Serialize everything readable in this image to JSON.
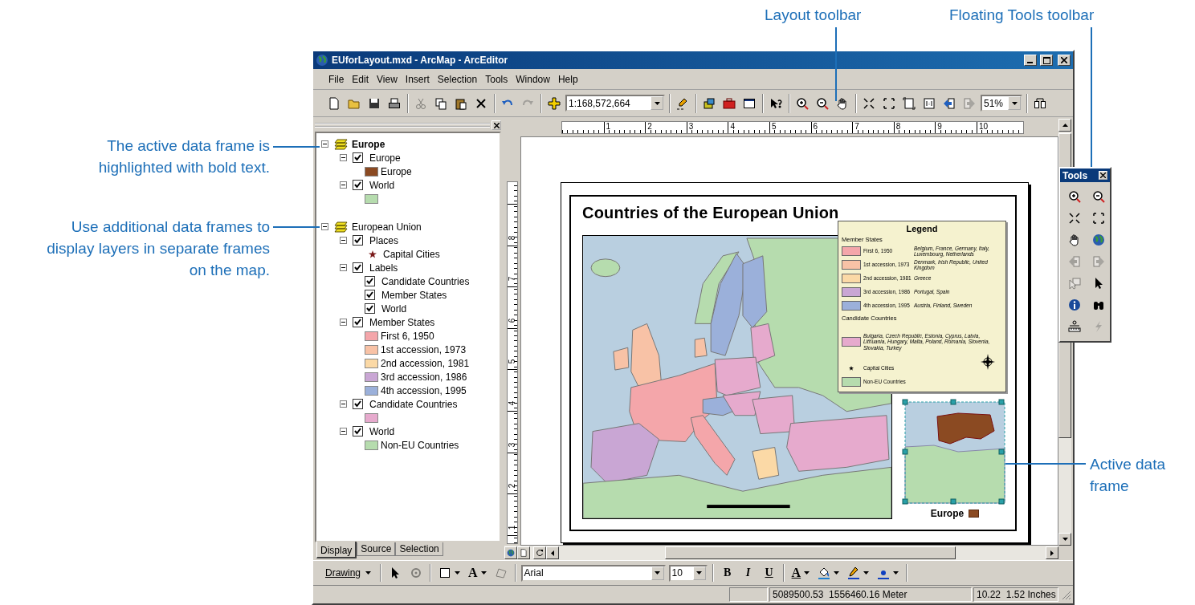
{
  "callouts": [
    "The active data frame is highlighted with bold text.",
    "Use additional data frames to display layers in separate frames on the map.",
    "Layout toolbar",
    "Floating Tools toolbar",
    "Active data frame"
  ],
  "window": {
    "title": "EUforLayout.mxd - ArcMap - ArcEditor"
  },
  "menu": [
    "File",
    "Edit",
    "View",
    "Insert",
    "Selection",
    "Tools",
    "Window",
    "Help"
  ],
  "toolbar": [
    [
      {
        "kind": "new",
        "disabled": false
      },
      {
        "kind": "open",
        "disabled": false
      },
      {
        "kind": "save",
        "disabled": false
      },
      {
        "kind": "print",
        "disabled": false
      }
    ],
    [
      {
        "kind": "cut",
        "disabled": true
      },
      {
        "kind": "copy",
        "disabled": false
      },
      {
        "kind": "paste",
        "disabled": false
      },
      {
        "kind": "delete",
        "disabled": false
      }
    ],
    [
      {
        "kind": "undo",
        "disabled": false
      },
      {
        "kind": "redo",
        "disabled": true
      }
    ],
    [
      {
        "kind": "add-data",
        "disabled": false
      },
      {
        "kind": "scale",
        "value": "1:168,572,664",
        "disabled": false
      }
    ],
    [
      {
        "kind": "editor",
        "disabled": false
      }
    ],
    [
      {
        "kind": "cabinet",
        "disabled": false
      },
      {
        "kind": "toolbox",
        "disabled": false
      },
      {
        "kind": "window",
        "disabled": false
      }
    ],
    [
      {
        "kind": "whats-this",
        "disabled": false
      }
    ],
    [
      {
        "kind": "zoom-in",
        "disabled": false
      },
      {
        "kind": "zoom-out",
        "disabled": false
      },
      {
        "kind": "pan",
        "disabled": false
      }
    ],
    [
      {
        "kind": "fixed-zoom-in",
        "disabled": false
      },
      {
        "kind": "fixed-zoom-out",
        "disabled": false
      },
      {
        "kind": "whole-page",
        "disabled": false
      },
      {
        "kind": "actual-size",
        "disabled": false
      },
      {
        "kind": "back",
        "disabled": false
      },
      {
        "kind": "forward",
        "disabled": true
      },
      {
        "kind": "zoom-level",
        "value": "51%",
        "disabled": false
      }
    ],
    [
      {
        "kind": "draft",
        "disabled": false
      }
    ]
  ],
  "toc": {
    "children": [
      {
        "name": "Europe",
        "active": true,
        "expanded": true,
        "children": [
          {
            "name": "Europe",
            "checked": true,
            "expanded": true,
            "children": [
              {
                "kind": "swatch",
                "color": "#8b4a22",
                "label": "Europe"
              }
            ]
          },
          {
            "name": "World",
            "checked": true,
            "expanded": true,
            "children": [
              {
                "kind": "swatch",
                "color": "#b6dcae"
              }
            ]
          }
        ]
      },
      {
        "name": "European Union",
        "active": false,
        "expanded": true,
        "children": [
          {
            "name": "Places",
            "checked": true,
            "expanded": true,
            "children": [
              {
                "kind": "star",
                "label": "Capital Cities"
              }
            ]
          },
          {
            "name": "Labels",
            "checked": true,
            "expanded": true,
            "children": [
              {
                "kind": "checkbox",
                "checked": true,
                "label": "Candidate Countries"
              },
              {
                "kind": "checkbox",
                "checked": true,
                "label": "Member States"
              },
              {
                "kind": "checkbox",
                "checked": true,
                "label": "World"
              }
            ]
          },
          {
            "name": "Member States",
            "checked": true,
            "expanded": true,
            "children": [
              {
                "kind": "swatch",
                "color": "#f4a6aa",
                "label": "First 6, 1950"
              },
              {
                "kind": "swatch",
                "color": "#f8c2a6",
                "label": "1st accession, 1973"
              },
              {
                "kind": "swatch",
                "color": "#fbd9a6",
                "label": "2nd accession, 1981"
              },
              {
                "kind": "swatch",
                "color": "#c9a6d4",
                "label": "3rd accession, 1986"
              },
              {
                "kind": "swatch",
                "color": "#9bb0da",
                "label": "4th accession, 1995"
              }
            ]
          },
          {
            "name": "Candidate Countries",
            "checked": true,
            "expanded": true,
            "children": [
              {
                "kind": "swatch",
                "color": "#e6aacd"
              }
            ]
          },
          {
            "name": "World",
            "checked": true,
            "expanded": true,
            "children": [
              {
                "kind": "swatch",
                "color": "#b6dcae",
                "label": "Non-EU Countries"
              }
            ]
          }
        ]
      }
    ]
  },
  "toc_tabs": [
    {
      "label": "Display",
      "selected": true
    },
    {
      "label": "Source",
      "selected": false
    },
    {
      "label": "Selection",
      "selected": false
    }
  ],
  "rulers": {
    "horizontal": [
      "1",
      "2",
      "3",
      "4",
      "5",
      "6",
      "7",
      "8",
      "9",
      "10"
    ],
    "vertical": [
      "8",
      "7",
      "6",
      "5",
      "4",
      "3",
      "2",
      "1"
    ]
  },
  "layout": {
    "title": "Countries of the European Union",
    "legend": {
      "title": "Legend",
      "sections": [
        {
          "heading": "Member States",
          "items": [
            {
              "kind": "swatch",
              "color": "#f4a6aa",
              "label": "First 6, 1950",
              "note": "Belgium, France, Germany, Italy, Luxembourg, Netherlands"
            },
            {
              "kind": "swatch",
              "color": "#f8c2a6",
              "label": "1st accession, 1973",
              "note": "Denmark, Irish Republic, United Kingdom"
            },
            {
              "kind": "swatch",
              "color": "#fbd9a6",
              "label": "2nd accession, 1981",
              "note": "Greece"
            },
            {
              "kind": "swatch",
              "color": "#c9a6d4",
              "label": "3rd accession, 1986",
              "note": "Portugal, Spain"
            },
            {
              "kind": "swatch",
              "color": "#9bb0da",
              "label": "4th accession, 1995",
              "note": "Austria, Finland, Sweden"
            }
          ]
        },
        {
          "heading": "Candidate Countries",
          "items": [
            {
              "kind": "swatch",
              "color": "#e6aacd",
              "note": "Bulgaria, Czech Republic, Estonia, Cyprus, Latvia, Lithuania, Hungary, Malta, Poland, Romania, Slovenia, Slovakia, Turkey"
            },
            {
              "kind": "star",
              "label": "Capital Cities"
            },
            {
              "kind": "swatch",
              "color": "#b6dcae",
              "label": "Non-EU Countries"
            }
          ]
        }
      ]
    },
    "inset": {
      "selected": true,
      "label": "Europe"
    }
  },
  "tools_palette": {
    "title": "Tools",
    "tools": [
      {
        "kind": "zoom-in",
        "disabled": false
      },
      {
        "kind": "zoom-out",
        "disabled": false
      },
      {
        "kind": "fixed-zoom-in",
        "disabled": false
      },
      {
        "kind": "fixed-zoom-out",
        "disabled": false
      },
      {
        "kind": "pan",
        "disabled": false
      },
      {
        "kind": "globe",
        "disabled": false
      },
      {
        "kind": "back",
        "disabled": true
      },
      {
        "kind": "forward",
        "disabled": true
      },
      {
        "kind": "select-features",
        "disabled": true
      },
      {
        "kind": "select",
        "disabled": false
      },
      {
        "kind": "identify",
        "disabled": false
      },
      {
        "kind": "find",
        "disabled": false
      },
      {
        "kind": "measure",
        "disabled": false
      },
      {
        "kind": "hyperlink",
        "disabled": true
      }
    ]
  },
  "drawing_toolbar": {
    "menu": "Drawing",
    "tools": [
      {
        "kind": "select",
        "disabled": false,
        "has_dropdown": false
      },
      {
        "kind": "rotate",
        "disabled": true,
        "has_dropdown": false
      },
      {
        "kind": "rectangle",
        "disabled": false,
        "has_dropdown": true
      },
      {
        "kind": "text",
        "label": "A",
        "disabled": false,
        "has_dropdown": true
      },
      {
        "kind": "edit-vertices",
        "disabled": true,
        "has_dropdown": false
      }
    ],
    "font": "Arial",
    "size": "10",
    "styles": [
      {
        "kind": "bold",
        "label": "B"
      },
      {
        "kind": "italic",
        "label": "I"
      },
      {
        "kind": "underline",
        "label": "U"
      }
    ],
    "colors": [
      {
        "kind": "font-color",
        "label": "A"
      },
      {
        "kind": "fill-color"
      },
      {
        "kind": "line-color"
      },
      {
        "kind": "marker-color"
      }
    ]
  },
  "status_bar": {
    "coordinates": "5089500.53  1556460.16 Meter",
    "page_position": "10.22  1.52 Inches"
  }
}
